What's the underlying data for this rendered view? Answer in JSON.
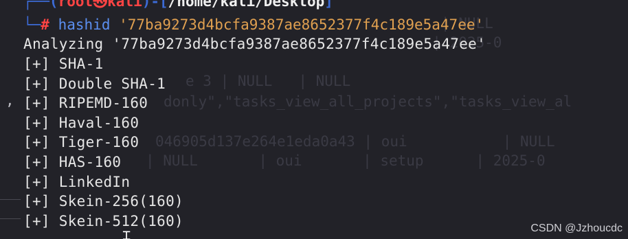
{
  "prompt": {
    "open_bracket": "┌──(",
    "user": "root",
    "skull": "㉿",
    "host": "kali",
    "mid": ")-[",
    "cwd": "/home/kali/Desktop",
    "close": "]",
    "corner": "└─",
    "hash": "#",
    "command": "hashid",
    "argument": "'77ba9273d4bcfa9387ae8652377f4c189e5a47ee'"
  },
  "output": [
    "Analyzing '77ba9273d4bcfa9387ae8652377f4c189e5a47ee'",
    "[+] SHA-1",
    "[+] Double SHA-1",
    "[+] RIPEMD-160",
    "[+] Haval-160",
    "[+] Tiger-160",
    "[+] HAS-160",
    "[+] LinkedIn",
    "[+] Skein-256(160)",
    "[+] Skein-512(160)"
  ],
  "ghost_text": [
    "c                              | NULL",
    "                              | 2025-0",
    "e 3 | NULL   | NULL",
    "donly\",\"tasks_view_all_projects\",\"tasks_view_al",
    "046905d137e264e1eda0a43 | oui           | NULL",
    "| NULL       | oui       | setup      | 2025-0"
  ],
  "watermark": "CSDN @Jzhoucdc",
  "colors": {
    "background": "#222228",
    "prompt_bracket": "#3c6bd6",
    "user": "#ff4444",
    "command": "#5b8ff0",
    "argument": "#e0a050",
    "text": "#e6e6e6"
  }
}
